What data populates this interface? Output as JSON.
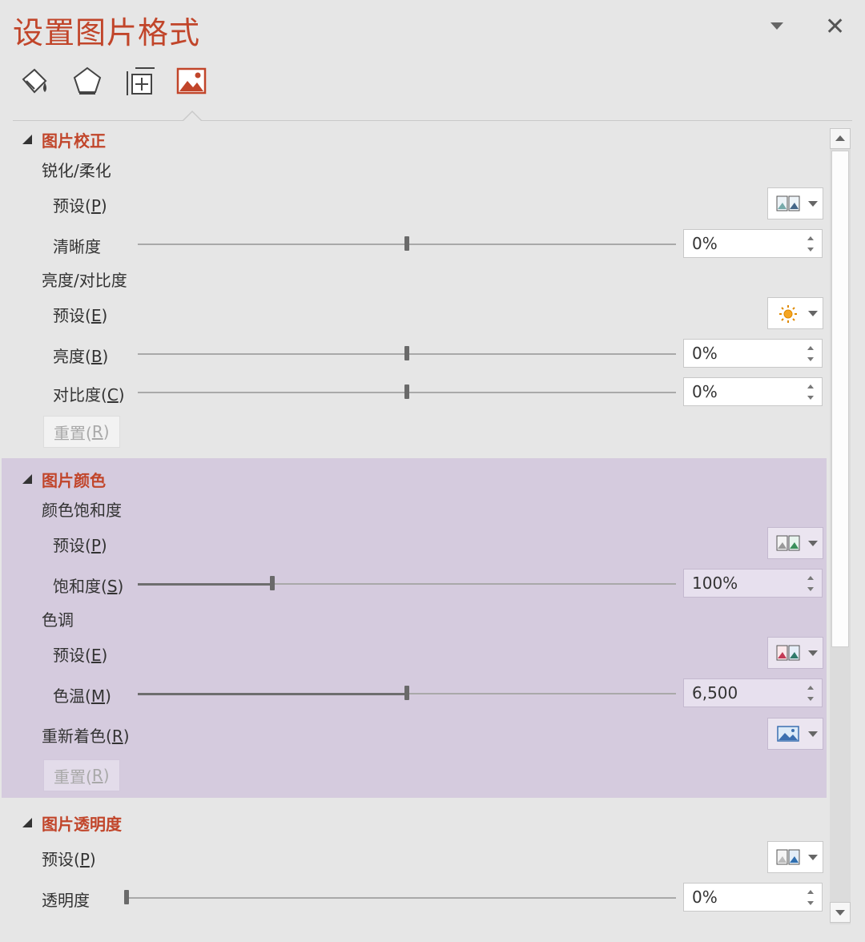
{
  "pane": {
    "title": "设置图片格式",
    "tabs": [
      {
        "icon": "paint-bucket-icon",
        "active": false
      },
      {
        "icon": "pentagon-icon",
        "active": false
      },
      {
        "icon": "size-position-icon",
        "active": false
      },
      {
        "icon": "picture-icon",
        "active": true
      }
    ]
  },
  "correction": {
    "title": "图片校正",
    "sharpen_heading": "锐化/柔化",
    "sharpen_preset_label": "预设(",
    "sharpen_preset_key": "P",
    "sharpness_label": "清晰度",
    "sharpness_value": "0%",
    "sharpness_level": 0.5,
    "bc_heading": "亮度/对比度",
    "bc_preset_label": "预设(",
    "bc_preset_key": "E",
    "brightness_label": "亮度(",
    "brightness_key": "B",
    "brightness_value": "0%",
    "brightness_level": 0.5,
    "contrast_label": "对比度(",
    "contrast_key": "C",
    "contrast_value": "0%",
    "contrast_level": 0.5,
    "reset_label": "重置(",
    "reset_key": "R"
  },
  "color": {
    "title": "图片颜色",
    "saturation_heading": "颜色饱和度",
    "sat_preset_label": "预设(",
    "sat_preset_key": "P",
    "saturation_label": "饱和度(",
    "saturation_key": "S",
    "saturation_value": "100%",
    "saturation_level": 0.25,
    "tone_heading": "色调",
    "tone_preset_label": "预设(",
    "tone_preset_key": "E",
    "temperature_label": "色温(",
    "temperature_key": "M",
    "temperature_value": "6,500",
    "temperature_level": 0.5,
    "recolor_label": "重新着色(",
    "recolor_key": "R",
    "reset_label": "重置(",
    "reset_key": "R"
  },
  "transparency": {
    "title": "图片透明度",
    "preset_label": "预设(",
    "preset_key": "P",
    "transparency_label": "透明度",
    "transparency_value": "0%",
    "transparency_level": 0.0
  },
  "colors": {
    "accent": "#c1452a",
    "section_highlight": "#d5cbde",
    "background": "#e6e6e6"
  }
}
